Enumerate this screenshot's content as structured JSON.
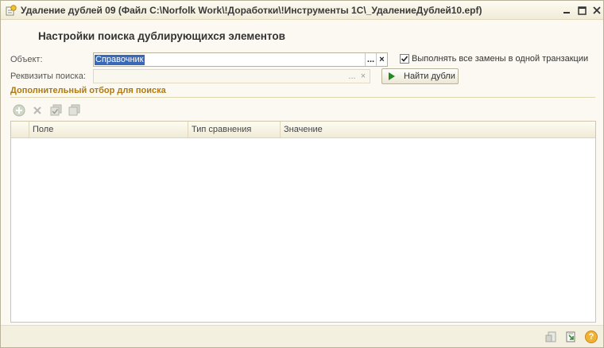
{
  "window": {
    "title": "Удаление дублей 09 (Файл C:\\Norfolk Work\\!Доработки\\!Инструменты 1С\\_УдалениеДублей10.epf)"
  },
  "form": {
    "heading": "Настройки поиска дублирующихся элементов",
    "object_label": "Объект:",
    "object_value": "Справочник",
    "object_select_btn": "...",
    "object_clear_btn": "×",
    "search_attrs_label": "Реквизиты поиска:",
    "search_attrs_select_btn": "...",
    "search_attrs_clear_btn": "×",
    "single_transaction_label": "Выполнять все замены в одной транзакции",
    "single_transaction_checked": true,
    "find_button_label": "Найти дубли"
  },
  "filter_section": {
    "title": "Дополнительный отбор для поиска",
    "columns": [
      "Поле",
      "Тип сравнения",
      "Значение"
    ],
    "rows": []
  },
  "colors": {
    "accent_section": "#b07a10",
    "selection": "#3969b6",
    "play": "#1f8a1f",
    "window_bg": "#fbf9f1"
  },
  "icons": {
    "toolbar": [
      "add-icon",
      "delete-icon",
      "check-all-icon",
      "uncheck-all-icon"
    ],
    "status": [
      "export-icon",
      "import-icon",
      "help-icon"
    ]
  }
}
